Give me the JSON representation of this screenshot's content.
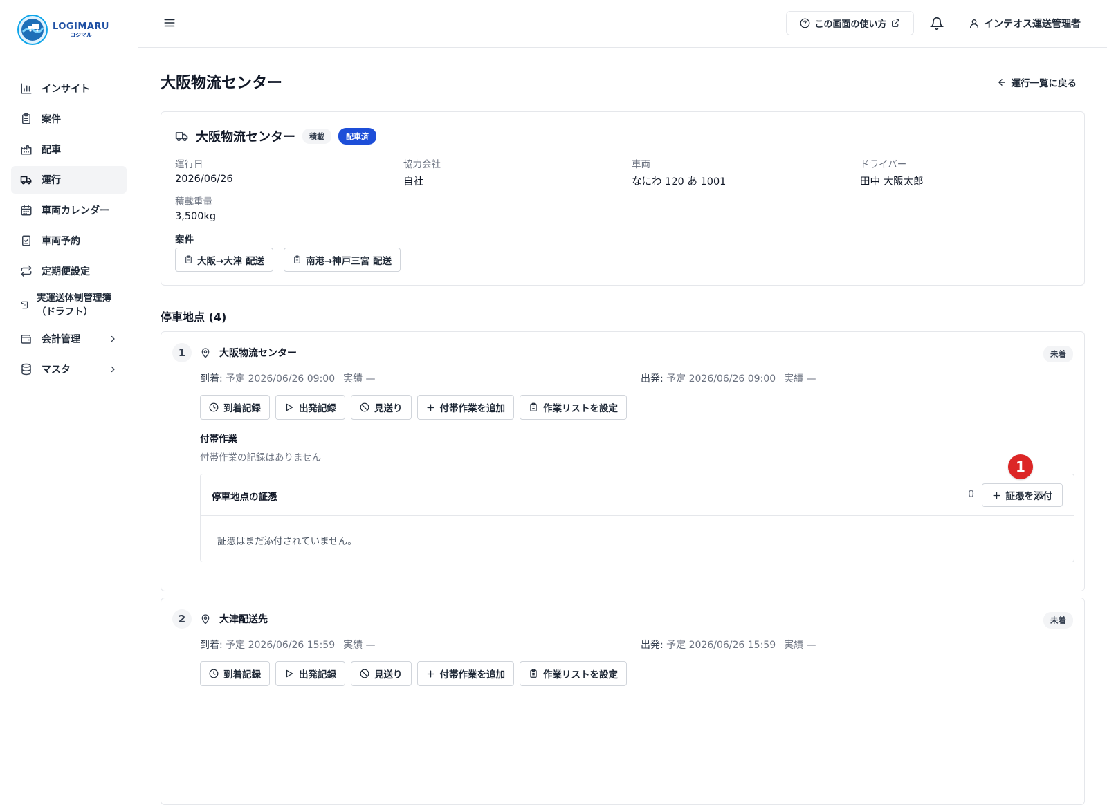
{
  "brand": {
    "name_en": "LOGIMARU",
    "name_ja": "ロジマル"
  },
  "sidebar": {
    "items": [
      {
        "label": "インサイト",
        "icon": "bar-chart-icon"
      },
      {
        "label": "案件",
        "icon": "clipboard-icon"
      },
      {
        "label": "配車",
        "icon": "factory-icon"
      },
      {
        "label": "運行",
        "icon": "truck-icon",
        "active": true
      },
      {
        "label": "車両カレンダー",
        "icon": "calendar-icon"
      },
      {
        "label": "車両予約",
        "icon": "clipboard-check-icon"
      },
      {
        "label": "定期便設定",
        "icon": "repeat-icon"
      },
      {
        "label_line1": "実運送体制管理簿",
        "label_line2": "（ドラフト）",
        "icon": "scroll-icon"
      },
      {
        "label": "会計管理",
        "icon": "wallet-icon",
        "has_children": true
      },
      {
        "label": "マスタ",
        "icon": "database-icon",
        "has_children": true
      }
    ]
  },
  "topbar": {
    "help_label": "この画面の使い方",
    "user_name": "インテオス運送管理者"
  },
  "page": {
    "title": "大阪物流センター",
    "back_label": "運行一覧に戻る"
  },
  "operation": {
    "title": "大阪物流センター",
    "tag_type": "積載",
    "tag_status": "配車済",
    "fields": {
      "date_label": "運行日",
      "date_value": "2026/06/26",
      "partner_label": "協力会社",
      "partner_value": "自社",
      "vehicle_label": "車両",
      "vehicle_value": "なにわ 120 あ 1001",
      "driver_label": "ドライバー",
      "driver_value": "田中 大阪太郎",
      "weight_label": "積載重量",
      "weight_value": "3,500kg"
    },
    "cases_label": "案件",
    "cases": [
      "大阪→大津 配送",
      "南港→神戸三宮 配送"
    ]
  },
  "stops_section": {
    "title": "停車地点 (4)"
  },
  "stops": [
    {
      "number": "1",
      "name": "大阪物流センター",
      "status": "未着",
      "arrival_label": "到着:",
      "arrival_plan": "予定 2026/06/26 09:00",
      "arrival_actual": "実績 —",
      "departure_label": "出発:",
      "departure_plan": "予定 2026/06/26 09:00",
      "departure_actual": "実績 —"
    },
    {
      "number": "2",
      "name": "大津配送先",
      "status": "未着",
      "arrival_label": "到着:",
      "arrival_plan": "予定 2026/06/26 15:59",
      "arrival_actual": "実績 —",
      "departure_label": "出発:",
      "departure_plan": "予定 2026/06/26 15:59",
      "departure_actual": "実績 —"
    }
  ],
  "stop_actions": {
    "arrival": "到着記録",
    "departure": "出発記録",
    "skip": "見送り",
    "add_task": "付帯作業を追加",
    "set_worklist": "作業リストを設定"
  },
  "tasks": {
    "title": "付帯作業",
    "empty": "付帯作業の記録はありません"
  },
  "evidence": {
    "title": "停車地点の証憑",
    "count": "0",
    "attach_label": "証憑を添付",
    "empty": "証憑はまだ添付されていません。"
  },
  "callout": {
    "number": "1",
    "color": "#dc2626"
  },
  "colors": {
    "accent": "#1d4ed8",
    "border": "#e5e7eb"
  }
}
